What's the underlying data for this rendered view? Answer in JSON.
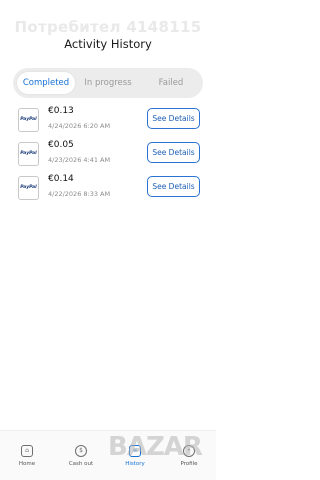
{
  "watermark": "Потребител 4148115",
  "page": {
    "title": "Activity History"
  },
  "tabs": [
    {
      "label": "Completed",
      "active": true
    },
    {
      "label": "In progress",
      "active": false
    },
    {
      "label": "Failed",
      "active": false
    }
  ],
  "transactions": [
    {
      "method_logo": "PayPal",
      "amount": "€0.13",
      "date": "4/24/2026 6:20 AM",
      "action": "See Details"
    },
    {
      "method_logo": "PayPal",
      "amount": "€0.05",
      "date": "4/23/2026 4:41 AM",
      "action": "See Details"
    },
    {
      "method_logo": "PayPal",
      "amount": "€0.14",
      "date": "4/22/2026 8:33 AM",
      "action": "See Details"
    }
  ],
  "nav": [
    {
      "label": "Home",
      "icon": "home-icon"
    },
    {
      "label": "Cash out",
      "icon": "cash-out-icon"
    },
    {
      "label": "History",
      "icon": "history-icon",
      "active": true
    },
    {
      "label": "Profile",
      "icon": "profile-icon"
    }
  ],
  "brand_overlay": "BAZAR",
  "colors": {
    "accent": "#1570d4",
    "tab_bg": "#ececec",
    "button_border": "#2a73d2"
  }
}
